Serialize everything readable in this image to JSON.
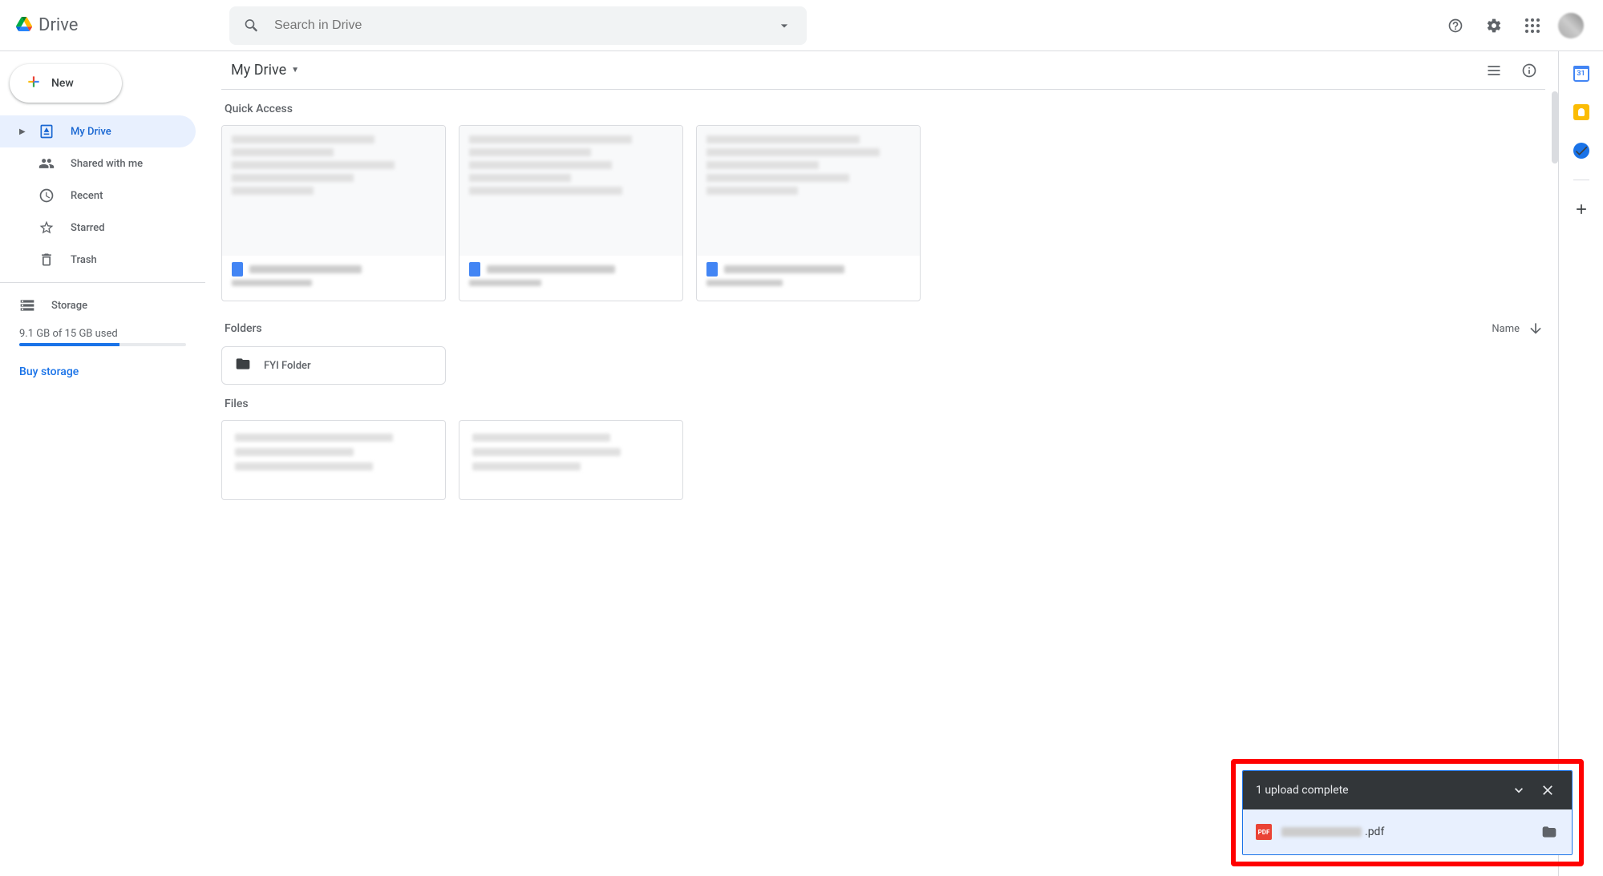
{
  "header": {
    "product_name": "Drive",
    "search_placeholder": "Search in Drive"
  },
  "sidebar": {
    "new_label": "New",
    "items": [
      {
        "label": "My Drive"
      },
      {
        "label": "Shared with me"
      },
      {
        "label": "Recent"
      },
      {
        "label": "Starred"
      },
      {
        "label": "Trash"
      }
    ],
    "storage_label": "Storage",
    "storage_used_text": "9.1 GB of 15 GB used",
    "storage_percent": 60,
    "buy_storage_label": "Buy storage"
  },
  "main": {
    "breadcrumb": "My Drive",
    "quick_access_label": "Quick Access",
    "folders_label": "Folders",
    "sort_label": "Name",
    "folders": [
      {
        "name": "FYI Folder"
      }
    ],
    "files_label": "Files"
  },
  "upload_toast": {
    "title": "1 upload complete",
    "file_type_badge": "PDF",
    "file_extension": ".pdf"
  },
  "side_panel": {
    "calendar_day": "31"
  }
}
